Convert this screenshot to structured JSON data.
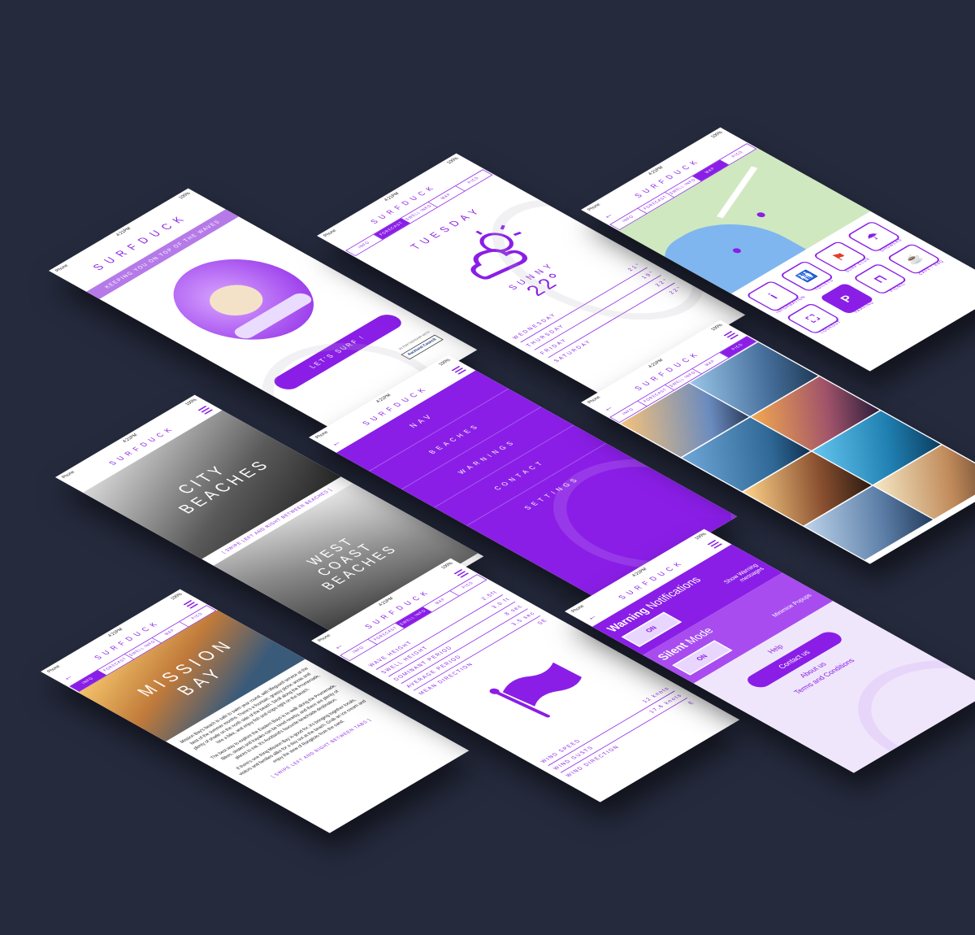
{
  "status": {
    "carrier": "Phone",
    "time": "4:21PM",
    "battery": "100%"
  },
  "brand": "SURFDUCK",
  "tabs": [
    "INFO",
    "FORECAST",
    "SWELL INFO",
    "MAP",
    "PICS"
  ],
  "splash": {
    "tagline": "KEEPING YOU ON TOP OF THE WAVES",
    "cta": "LET'S SURF !",
    "partner": "IN PARTNERSHIP WITH",
    "partner_logo": "Auckland Council"
  },
  "forecast": {
    "day": "TUESDAY",
    "condition": "SUNNY",
    "temp": "22°",
    "days": [
      {
        "name": "WEDNESDAY",
        "temp": "21°"
      },
      {
        "name": "THURSDAY",
        "temp": "19°"
      },
      {
        "name": "FRIDAY",
        "temp": "22°"
      },
      {
        "name": "SATURDAY",
        "temp": "22°"
      }
    ]
  },
  "map": {
    "icons": [
      {
        "label": "INFORMATION",
        "glyph": "i"
      },
      {
        "label": "TOILETS",
        "glyph": "🚻"
      },
      {
        "label": "SURF CLUB",
        "glyph": "⚑"
      },
      {
        "label": "SHOWERS",
        "glyph": "☂"
      },
      {
        "label": "LOOKOUT",
        "glyph": "⛶"
      },
      {
        "label": "PARKING",
        "glyph": "P"
      },
      {
        "label": "PICNIC",
        "glyph": "⊓"
      },
      {
        "label": "CAFE / BBQ",
        "glyph": "☕"
      }
    ]
  },
  "beaches": {
    "city": "CITY BEACHES",
    "hint": "[ SWIPE LEFT AND RIGHT BETWEEN BEACHES ]",
    "west": "WEST COAST BEACHES"
  },
  "nav": {
    "title": "NAV",
    "items": [
      "BEACHES",
      "WARNINGS",
      "CONTACT",
      "SETTINGS"
    ]
  },
  "info": {
    "title": "MISSION BAY",
    "para1": "Mission Bay's beach is safe to swim year round, with lifeguard service at the best of the summer months. There's a fountain, grassy picnic areas and plenty of shade on the north side of the beach. Stroll along the Promenade, hire a bike, and enjoy fish and chips right on the beach.",
    "para2": "The best way to explore the Eastern Bays is to walk along the Promenade. Bikes, skates and kayaks can be hired nearby, and there are plenty of places to eat. It's Auckland's favourite beachside destination.",
    "para3": "If there's one thing Mission Bay is good for, it's bringing together locals, visitors and families alike for a day out at the beach. Grab an ice cream and enjoy the view of Rangitoto from the sand.",
    "hint": "[ SWIPE LEFT AND RIGHT BETWEEN TABS ]"
  },
  "swell": {
    "rows": [
      {
        "k": "WAVE HEIGHT",
        "v": "2.5ft"
      },
      {
        "k": "SWELL HEIGHT",
        "v": "3.0 ft"
      },
      {
        "k": "DOMINANT PERIOD",
        "v": "8 sec"
      },
      {
        "k": "AVERAGE PERIOD",
        "v": "3.5 sec"
      },
      {
        "k": "MEAN DIRECTION",
        "v": "SE"
      }
    ],
    "wind": [
      {
        "k": "WIND SPEED",
        "v": "12 knots"
      },
      {
        "k": "WIND GUSTS",
        "v": "17.6 knots"
      },
      {
        "k": "WIND DIRECTION",
        "v": "E"
      }
    ]
  },
  "settings": {
    "warn_bold": "Warning",
    "warn_rest": " Notifications",
    "warn_desc": "Show Warning messages",
    "warn_state": "ON",
    "silent_bold": "Silent",
    "silent_rest": " Mode",
    "silent_desc": "Minimise Popups",
    "silent_state": "ON",
    "help": "Help",
    "contact": "Contact us",
    "about": "About us",
    "terms": "Terms and Conditions"
  }
}
